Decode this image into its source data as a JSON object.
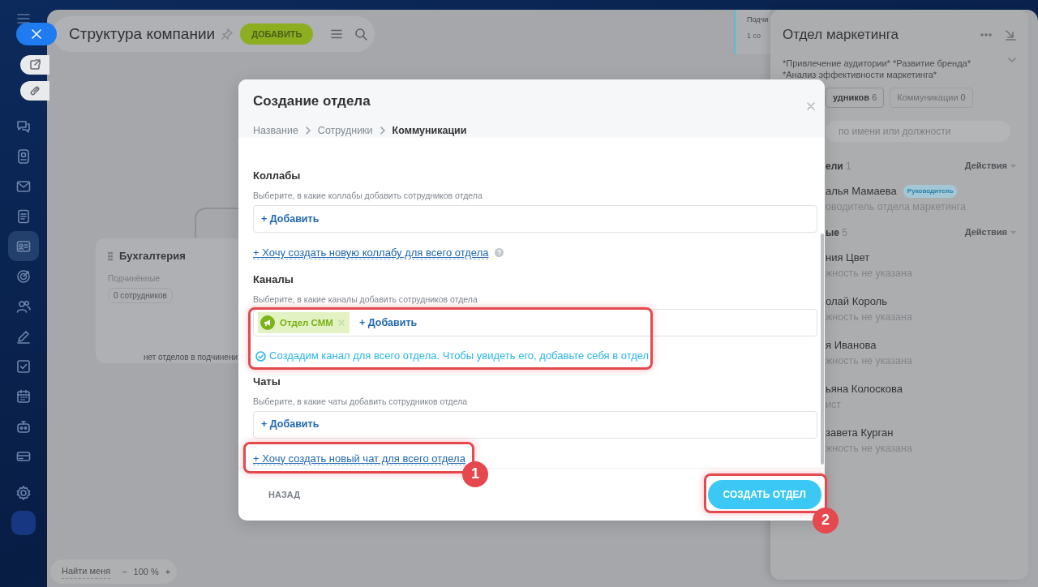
{
  "sidebar": {
    "items": [
      {
        "selected": false
      },
      {
        "selected": false
      },
      {
        "selected": false
      },
      {
        "selected": false
      },
      {
        "selected": true
      },
      {
        "selected": false
      },
      {
        "selected": false
      },
      {
        "selected": false
      },
      {
        "selected": false
      },
      {
        "selected": false
      },
      {
        "selected": false
      },
      {
        "selected": false
      }
    ]
  },
  "header": {
    "title": "Структура компании",
    "add_button": "ДОБАВИТЬ"
  },
  "canvas": {
    "department": {
      "title": "Бухгалтерия",
      "subordinates_label": "Подчинённые",
      "employees": "0 сотрудников",
      "empty_note": "нет отделов в подчинени"
    },
    "background_card": {
      "label": "Подчи",
      "count": "1 со"
    }
  },
  "zoom_bar": {
    "find_me": "Найти меня",
    "minus": "−",
    "zoom": "100 %",
    "plus": "+"
  },
  "side_panel": {
    "title": "Отдел маркетинга",
    "description": "*Привлечение аудитории* *Развитие бренда* *Анализ эффективности маркетинга*",
    "tabs": [
      {
        "label": "удников",
        "count": "6",
        "selected": true
      },
      {
        "label": "Коммуникации",
        "count": "0",
        "selected": false
      }
    ],
    "search_placeholder": "по имени или должности",
    "groups": [
      {
        "title": "ели",
        "count": "1",
        "actions": "Действия",
        "members": [
          {
            "name": "алья Мамаева",
            "badge": "Руководитель",
            "position": "оводитель отдела маркетинга"
          }
        ]
      },
      {
        "title": "ые",
        "count": "5",
        "actions": "Действия",
        "members": [
          {
            "name": "ния Цвет",
            "position": "жность не указана"
          },
          {
            "name": "олай Король",
            "position": "жность не указана"
          },
          {
            "name": "я Иванова",
            "position": "жность не указана"
          },
          {
            "name": "ьяна Колоскова",
            "position": "ист"
          },
          {
            "name": "завета Курган",
            "position": "жность не указана"
          }
        ]
      }
    ]
  },
  "modal": {
    "title": "Создание отдела",
    "steps": [
      {
        "label": "Название",
        "selected": false
      },
      {
        "label": "Сотрудники",
        "selected": false
      },
      {
        "label": "Коммуникации",
        "selected": true
      }
    ],
    "sections": [
      {
        "title": "Коллабы",
        "hint": "Выберите, в какие коллабы добавить сотрудников отдела",
        "add_label": "+ Добавить",
        "create_link": "+ Хочу создать новую коллабу для всего отдела",
        "help": true,
        "highlighted": false,
        "link_highlighted": false
      },
      {
        "title": "Каналы",
        "hint": "Выберите, в какие каналы добавить сотрудников отдела",
        "chips": [
          {
            "label": "Отдел СММ"
          }
        ],
        "add_label": "+ Добавить",
        "notice": "Создадим канал для всего отдела. Чтобы увидеть его, добавьте себя в отдел",
        "help": false,
        "highlighted": true,
        "link_highlighted": false
      },
      {
        "title": "Чаты",
        "hint": "Выберите, в какие чаты добавить сотрудников отдела",
        "add_label": "+ Добавить",
        "create_link": "+ Хочу создать новый чат для всего отдела",
        "help": false,
        "highlighted": false,
        "link_highlighted": true,
        "marker": "1"
      }
    ],
    "back_button": "НАЗАД",
    "submit": {
      "label": "СОЗДАТЬ ОТДЕЛ",
      "highlighted": true,
      "marker": "2"
    }
  }
}
